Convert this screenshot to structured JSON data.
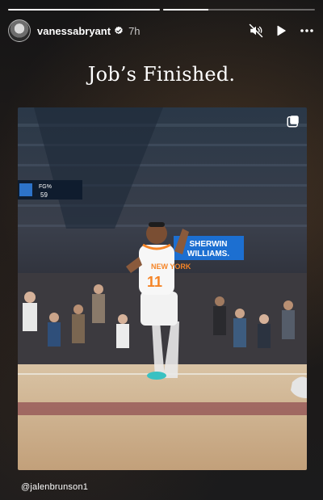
{
  "story": {
    "progress": [
      1,
      0.3
    ],
    "username": "vanessabryant",
    "time": "7h",
    "caption": "Job’s Finished.",
    "mention": "@jalenbrunson1"
  },
  "photo": {
    "scoreboard_label": "FG%",
    "scoreboard_value": "59",
    "banner_line1": "SHERWIN",
    "banner_line2": "WILLIAMS.",
    "jersey_number": "11"
  },
  "icons": {
    "verified": "verified-badge-icon",
    "mute": "muted-speaker-icon",
    "play": "play-icon",
    "more": "more-dots-icon",
    "repost": "repost-icon"
  },
  "colors": {
    "knicks_blue": "#1a7bd6",
    "knicks_orange": "#f58426",
    "banner_blue": "#1c6fd1"
  }
}
